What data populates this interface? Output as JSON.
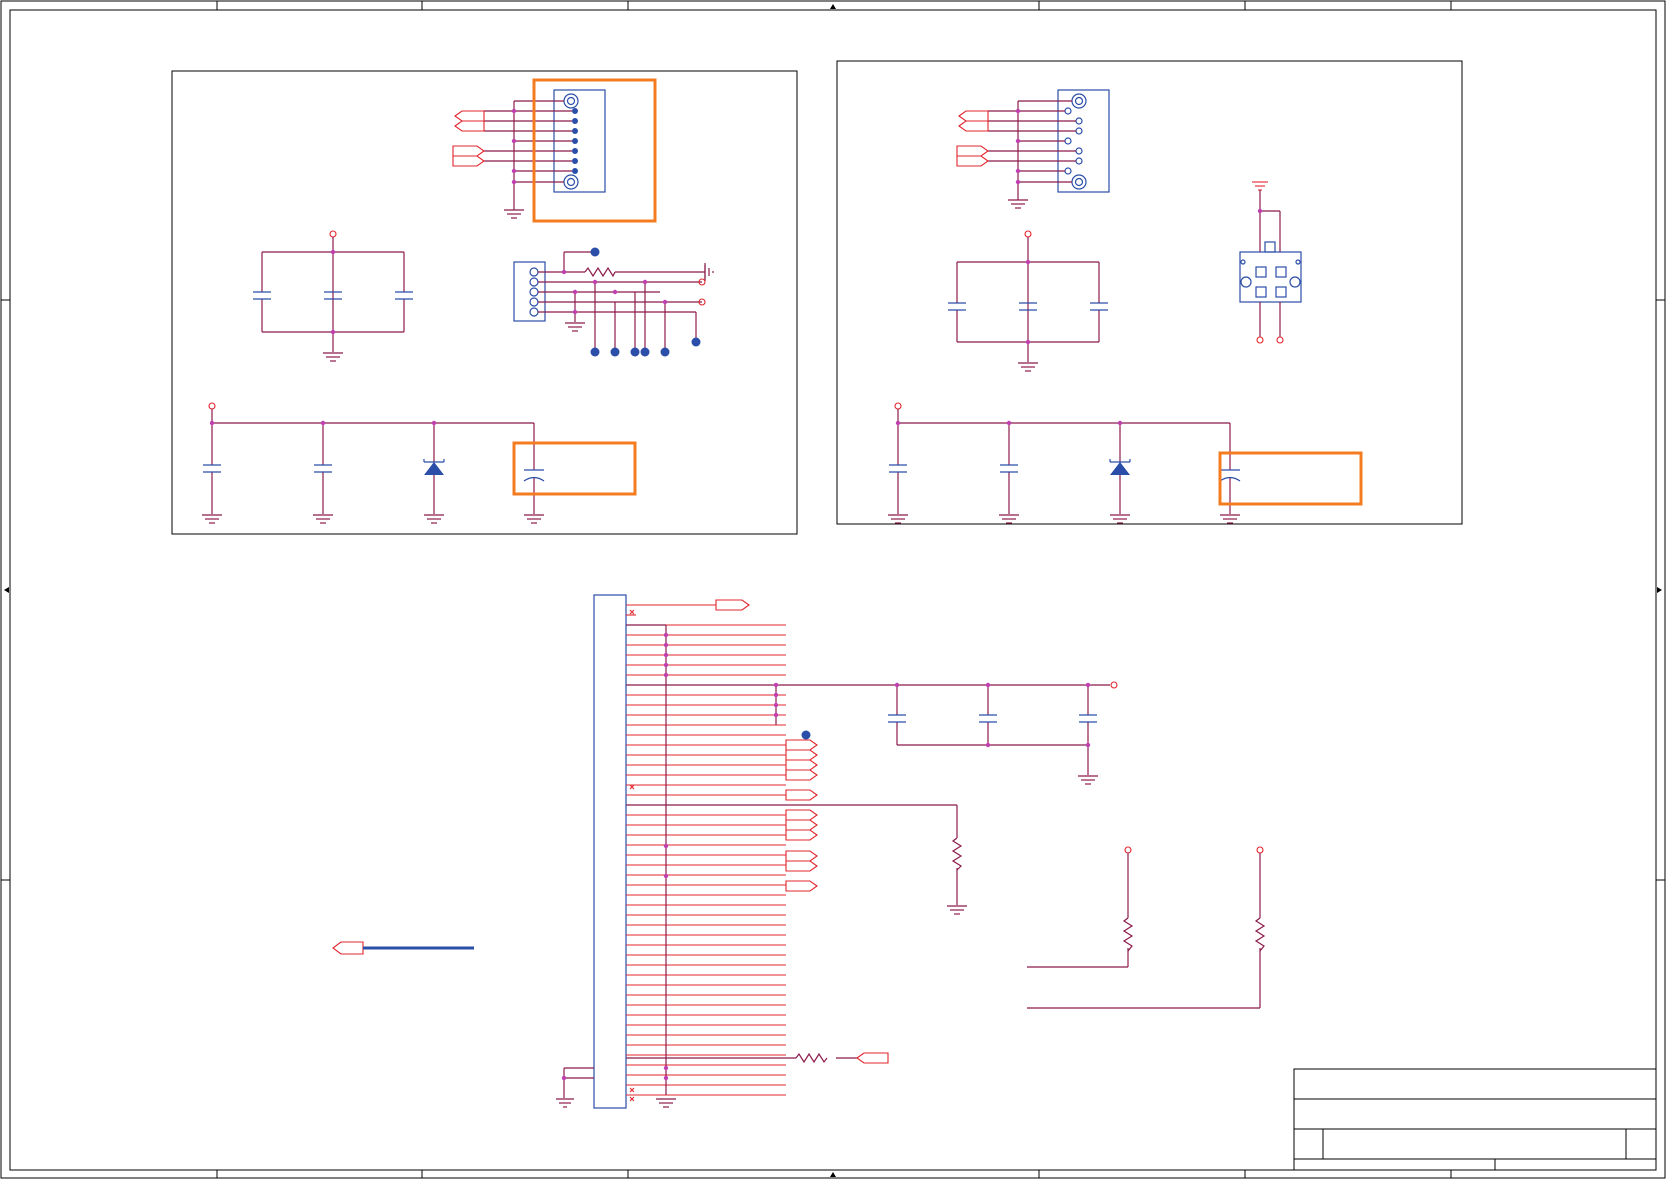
{
  "colors": {
    "frame": "#000000",
    "wire": "#8b1a4a",
    "pin": "#e0242c",
    "component": "#2b4ea8",
    "junction": "#c040b0",
    "highlight": "#f47c20"
  },
  "title_block": {
    "title": "",
    "doc_number": "",
    "rev": ""
  },
  "icons": [
    "ground-symbol",
    "power-port",
    "off-page-connector",
    "capacitor",
    "resistor",
    "diode",
    "connector"
  ]
}
